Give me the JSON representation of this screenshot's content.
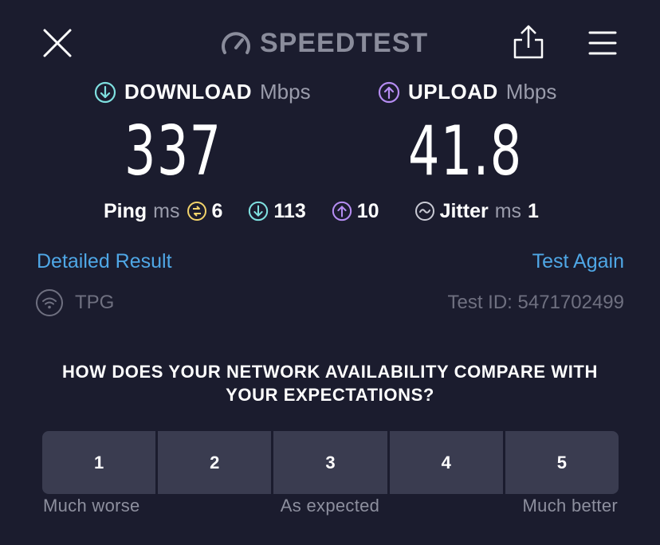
{
  "header": {
    "brand": "SPEEDTEST",
    "icons": [
      "close-icon",
      "speedometer-icon",
      "share-icon",
      "hamburger-menu-icon"
    ]
  },
  "download": {
    "label": "DOWNLOAD",
    "unit": "Mbps",
    "value": "337",
    "icon": "download-arrow-icon",
    "color": "#7fe0e0"
  },
  "upload": {
    "label": "UPLOAD",
    "unit": "Mbps",
    "value": "41.8",
    "icon": "upload-arrow-icon",
    "color": "#b58cf2"
  },
  "ping": {
    "label": "Ping",
    "unit": "ms",
    "idle": "6",
    "download": "113",
    "upload": "10",
    "idle_color": "#f2d36b"
  },
  "jitter": {
    "label": "Jitter",
    "unit": "ms",
    "value": "1"
  },
  "links": {
    "detailed": "Detailed Result",
    "again": "Test Again",
    "color": "#4fa7e6"
  },
  "provider": {
    "name": "TPG",
    "icon": "wifi-icon"
  },
  "test_id": "Test ID: 5471702499",
  "survey": {
    "question_line1": "HOW DOES YOUR NETWORK AVAILABILITY COMPARE WITH",
    "question_line2": "YOUR EXPECTATIONS?",
    "options": [
      "1",
      "2",
      "3",
      "4",
      "5"
    ],
    "label_low": "Much worse",
    "label_mid": "As expected",
    "label_high": "Much better"
  }
}
